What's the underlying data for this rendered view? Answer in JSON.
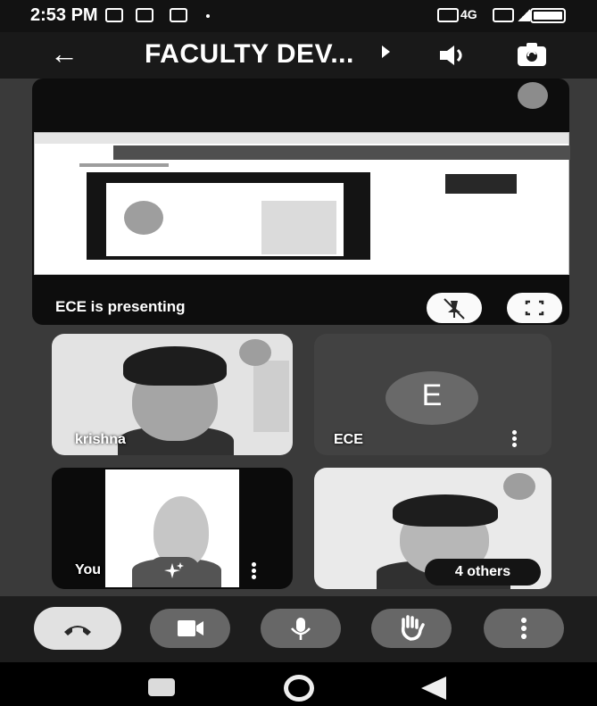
{
  "status_bar": {
    "time": "2:53 PM",
    "network": "4G"
  },
  "top_bar": {
    "back_icon": "arrow-left-icon",
    "title": "FACULTY DEV...",
    "speaker_icon": "speaker-icon",
    "switch_camera_icon": "switch-camera-icon"
  },
  "presentation": {
    "label": "ECE is presenting"
  },
  "participants": {
    "krishna": {
      "name": "krishna"
    },
    "ece": {
      "name": "ECE",
      "avatar_letter": "E"
    },
    "you": {
      "name": "You"
    },
    "others": {
      "label": "4 others"
    }
  },
  "controls": [
    "leave-call",
    "camera",
    "microphone",
    "raise-hand",
    "more-options"
  ]
}
